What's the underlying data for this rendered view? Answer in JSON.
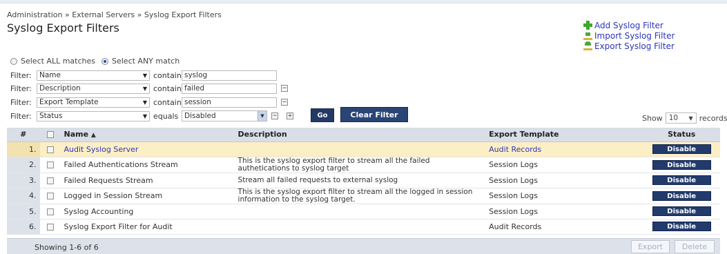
{
  "breadcrumb": "Administration » External Servers » Syslog Export Filters",
  "title": "Syslog Export Filters",
  "actions": [
    {
      "label": "Add Syslog Filter",
      "icon": "add-icon"
    },
    {
      "label": "Import Syslog Filter",
      "icon": "import-icon"
    },
    {
      "label": "Export Syslog Filter",
      "icon": "export-icon"
    }
  ],
  "match": {
    "all_label": "Select ALL matches",
    "any_label": "Select ANY match",
    "selected": "any"
  },
  "filters": [
    {
      "label": "Filter:",
      "field": "Name",
      "op": "contains",
      "value": "syslog"
    },
    {
      "label": "Filter:",
      "field": "Description",
      "op": "contains",
      "value": "failed"
    },
    {
      "label": "Filter:",
      "field": "Export Template",
      "op": "contains",
      "value": "session"
    },
    {
      "label": "Filter:",
      "field": "Status",
      "op": "equals",
      "value": "Disabled"
    }
  ],
  "buttons": {
    "go": "Go",
    "clear": "Clear Filter",
    "export": "Export",
    "delete": "Delete"
  },
  "paging": {
    "show": "Show",
    "count": "10",
    "records": "records"
  },
  "table": {
    "headers": {
      "num": "#",
      "name": "Name",
      "description": "Description",
      "template": "Export Template",
      "status": "Status"
    },
    "rows": [
      {
        "num": "1.",
        "name": "Audit Syslog Server",
        "description": "",
        "template": "Audit Records",
        "status": "Disable"
      },
      {
        "num": "2.",
        "name": "Failed Authentications Stream",
        "description": "This is the syslog export filter to stream all the failed authetications to syslog target",
        "template": "Session Logs",
        "status": "Disable"
      },
      {
        "num": "3.",
        "name": "Failed Requests Stream",
        "description": "Stream all failed requests to external syslog",
        "template": "Session Logs",
        "status": "Disable"
      },
      {
        "num": "4.",
        "name": "Logged in Session Stream",
        "description": "This is the syslog export filter to stream all the logged in session information to the syslog target.",
        "template": "Session Logs",
        "status": "Disable"
      },
      {
        "num": "5.",
        "name": "Syslog Accounting",
        "description": "",
        "template": "Session Logs",
        "status": "Disable"
      },
      {
        "num": "6.",
        "name": "Syslog Export Filter for Audit",
        "description": "",
        "template": "Audit Records",
        "status": "Disable"
      }
    ]
  },
  "footer": {
    "showing": "Showing 1-6 of 6"
  }
}
